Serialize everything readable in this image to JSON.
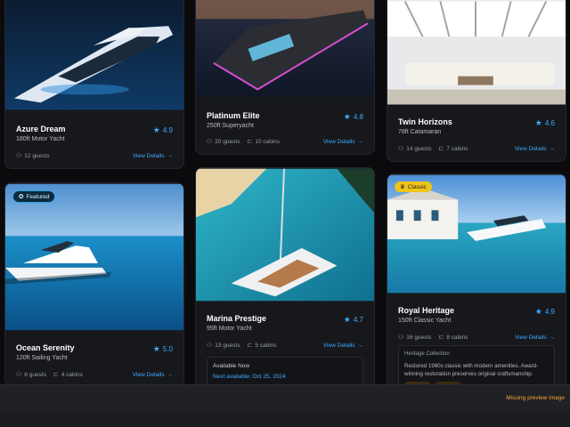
{
  "cards": [
    {
      "name": "Azure Dream",
      "sub": "180ft Motor Yacht",
      "rating": "4.9",
      "guests": "12 guests",
      "cabins": "",
      "details": "View Details"
    },
    {
      "name": "Platinum Elite",
      "sub": "250ft Superyacht",
      "rating": "4.8",
      "guests": "20 guests",
      "cabins": "10 cabins",
      "details": "View Details"
    },
    {
      "name": "Twin Horizons",
      "sub": "78ft Catamaran",
      "rating": "4.6",
      "guests": "14 guests",
      "cabins": "7 cabins",
      "details": "View Details"
    },
    {
      "name": "Ocean Serenity",
      "sub": "120ft Sailing Yacht",
      "rating": "5.0",
      "guests": "8 guests",
      "cabins": "4 cabins",
      "details": "View Details",
      "badge": "Featured"
    },
    {
      "name": "Marina Prestige",
      "sub": "95ft Motor Yacht",
      "rating": "4.7",
      "guests": "13 guests",
      "cabins": "5 cabins",
      "details": "View Details",
      "availability": {
        "label": "Available Now",
        "next": "Next available: Oct 25, 2024"
      }
    },
    {
      "name": "Royal Heritage",
      "sub": "150ft Classic Yacht",
      "rating": "4.9",
      "guests": "16 guests",
      "cabins": "8 cabins",
      "details": "View Details",
      "badge": "Classic",
      "heritage": {
        "label": "Heritage Collection",
        "text": "Restored 1960s classic with modern amenities. Award-winning restoration preserves original craftsmanship."
      }
    }
  ],
  "footer": {
    "missing_preview": "Missing preview image"
  },
  "icons": {
    "star": "star-icon",
    "guests": "users-icon",
    "cabins": "bed-icon",
    "arrow": "arrow-right-icon"
  },
  "colors": {
    "accent": "#3fa9ff",
    "classic_badge": "#f0c419",
    "featured_badge_border": "#2aa8e0"
  }
}
